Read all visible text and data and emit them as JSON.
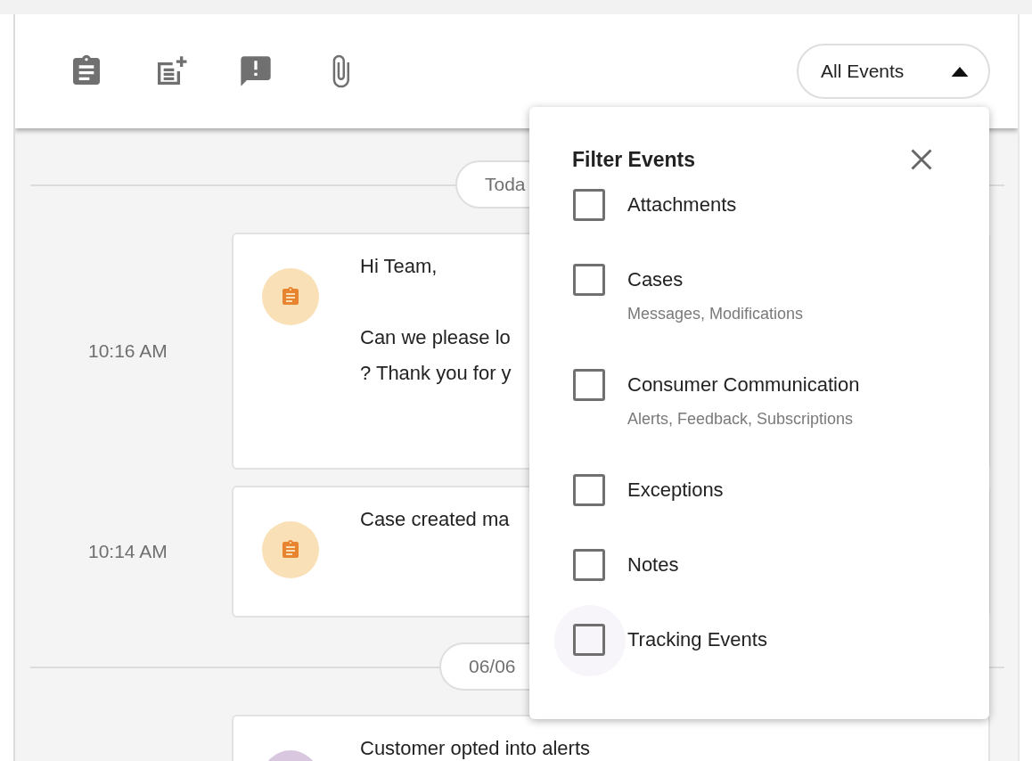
{
  "toolbar": {
    "filter_button": {
      "label": "All Events",
      "expanded": true
    }
  },
  "timeline": [
    {
      "date": "Toda",
      "events": [
        {
          "time": "10:16 AM",
          "kind": "case",
          "color": "#f9e0b7",
          "paragraphs": [
            [
              "Hi Team,"
            ],
            [
              "Can we please lo",
              "? Thank you for y"
            ]
          ]
        },
        {
          "time": "10:14 AM",
          "kind": "case",
          "color": "#f9e0b7",
          "paragraphs": [
            [
              "Case created ma"
            ]
          ]
        }
      ]
    },
    {
      "date": "06/06",
      "events": [
        {
          "kind": "alert",
          "color": "#d9c7e0",
          "paragraphs": [
            [
              "Customer opted into alerts"
            ]
          ]
        }
      ]
    }
  ],
  "filter_popup": {
    "title": "Filter Events",
    "options": [
      {
        "label": "Attachments",
        "checked": false
      },
      {
        "label": "Cases",
        "sublabel": "Messages, Modifications",
        "checked": false
      },
      {
        "label": "Consumer Communication",
        "sublabel": "Alerts, Feedback, Subscriptions",
        "checked": false
      },
      {
        "label": "Exceptions",
        "checked": false
      },
      {
        "label": "Notes",
        "checked": false
      },
      {
        "label": "Tracking Events",
        "checked": false,
        "hovered": true
      }
    ]
  }
}
